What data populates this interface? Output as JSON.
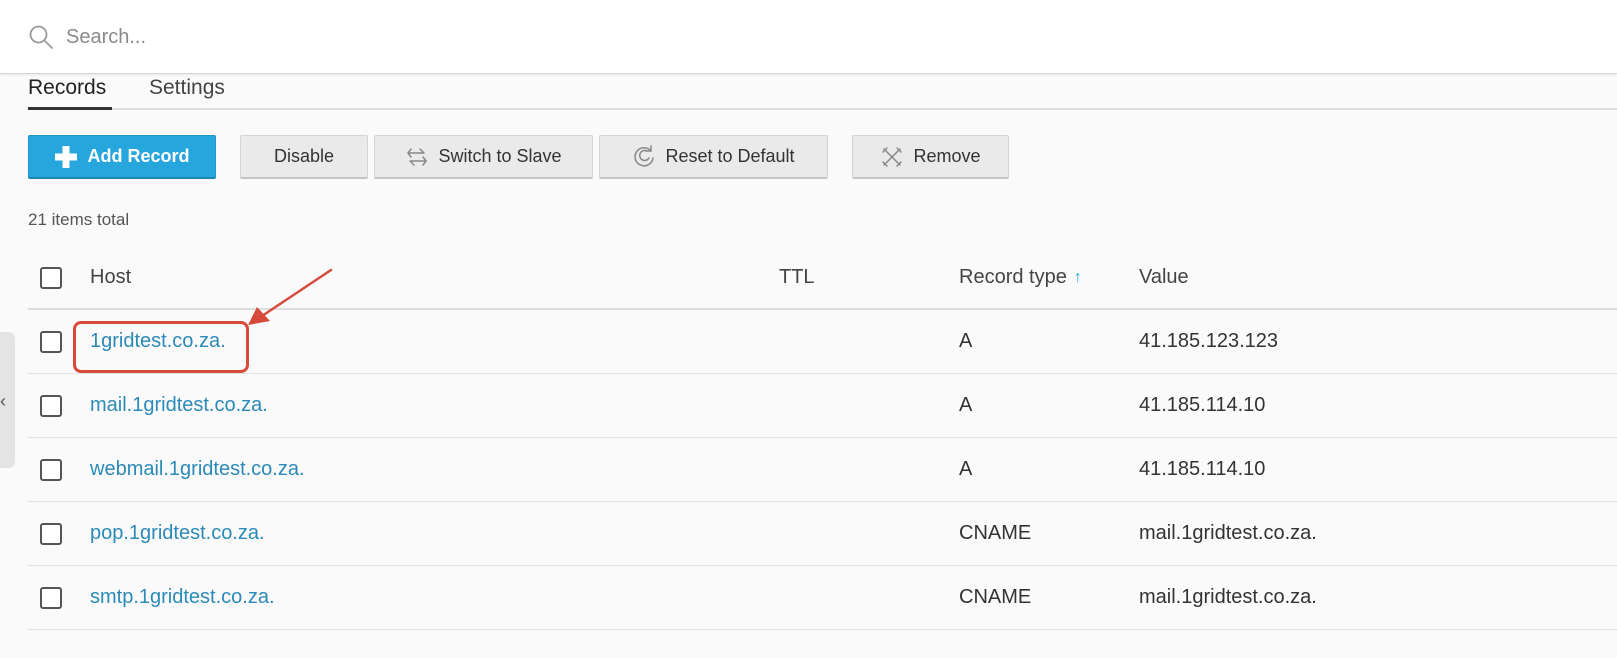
{
  "search": {
    "placeholder": "Search..."
  },
  "tabs": [
    {
      "label": "Records",
      "active": true
    },
    {
      "label": "Settings",
      "active": false
    }
  ],
  "toolbar": {
    "add_record": "Add Record",
    "disable": "Disable",
    "switch_to_slave": "Switch to Slave",
    "reset_to_default": "Reset to Default",
    "remove": "Remove"
  },
  "items_total": "21 items total",
  "table": {
    "columns": {
      "host": "Host",
      "ttl": "TTL",
      "record_type": "Record type",
      "value": "Value"
    },
    "sort_indicator": "↑",
    "rows": [
      {
        "host": "1gridtest.co.za.",
        "ttl": "",
        "type": "A",
        "value": "41.185.123.123"
      },
      {
        "host": "mail.1gridtest.co.za.",
        "ttl": "",
        "type": "A",
        "value": "41.185.114.10"
      },
      {
        "host": "webmail.1gridtest.co.za.",
        "ttl": "",
        "type": "A",
        "value": "41.185.114.10"
      },
      {
        "host": "pop.1gridtest.co.za.",
        "ttl": "",
        "type": "CNAME",
        "value": "mail.1gridtest.co.za."
      },
      {
        "host": "smtp.1gridtest.co.za.",
        "ttl": "",
        "type": "CNAME",
        "value": "mail.1gridtest.co.za."
      }
    ]
  },
  "side_panel": {
    "toggle_icon": "‹"
  },
  "colors": {
    "accent": "#27a6de",
    "link": "#2b8ab8",
    "annotation": "#d64a3c"
  },
  "icons": {
    "search": "search-icon",
    "add": "plus-icon",
    "switch": "switch-icon",
    "reset": "reset-icon",
    "remove": "remove-icon",
    "collapse": "chevron-left-icon"
  }
}
